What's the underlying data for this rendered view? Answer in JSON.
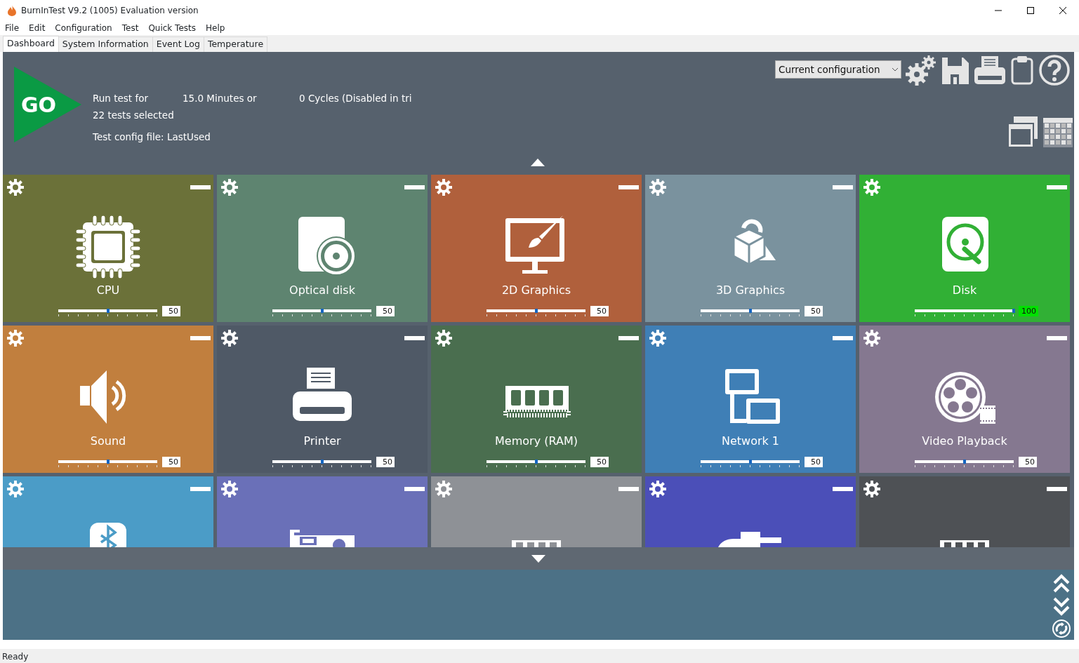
{
  "window": {
    "title": "BurnInTest V9.2 (1005) Evaluation version"
  },
  "menu": [
    "File",
    "Edit",
    "Configuration",
    "Test",
    "Quick Tests",
    "Help"
  ],
  "tabs": [
    {
      "label": "Dashboard",
      "selected": true
    },
    {
      "label": "System Information",
      "selected": false
    },
    {
      "label": "Event Log",
      "selected": false
    },
    {
      "label": "Temperature",
      "selected": false
    }
  ],
  "go_button": "GO",
  "run_info": {
    "run_label": "Run test for",
    "duration": "15.0 Minutes or",
    "cycles": "0 Cycles (Disabled in tri",
    "tests_selected": "22 tests selected",
    "config_file": "Test config file: LastUsed"
  },
  "config_select": {
    "value": "Current configuration"
  },
  "tiles": [
    {
      "kind": "cpu",
      "name": "CPU",
      "color": "#6b7139",
      "level": 0.5,
      "reading": "50",
      "maxed": false
    },
    {
      "kind": "optical",
      "name": "Optical disk",
      "color": "#5e8470",
      "level": 0.5,
      "reading": "50",
      "maxed": false
    },
    {
      "kind": "graphics2d",
      "name": "2D Graphics",
      "color": "#b0603c",
      "level": 0.5,
      "reading": "50",
      "maxed": false
    },
    {
      "kind": "graphics3d",
      "name": "3D Graphics",
      "color": "#7a929e",
      "level": 0.5,
      "reading": "50",
      "maxed": false
    },
    {
      "kind": "disk",
      "name": "Disk",
      "color": "#31b035",
      "level": 1,
      "reading": "100",
      "maxed": true
    },
    {
      "kind": "sound",
      "name": "Sound",
      "color": "#c17f3e",
      "level": 0.5,
      "reading": "50",
      "maxed": false
    },
    {
      "kind": "printer",
      "name": "Printer",
      "color": "#4f5966",
      "level": 0.5,
      "reading": "50",
      "maxed": false
    },
    {
      "kind": "memory",
      "name": "Memory (RAM)",
      "color": "#4a6e4f",
      "level": 0.5,
      "reading": "50",
      "maxed": false
    },
    {
      "kind": "network",
      "name": "Network 1",
      "color": "#3f7fb6",
      "level": 0.5,
      "reading": "50",
      "maxed": false
    },
    {
      "kind": "video",
      "name": "Video Playback",
      "color": "#857890",
      "level": 0.5,
      "reading": "50",
      "maxed": false
    },
    {
      "kind": "bluetooth",
      "color": "#4b9cc7"
    },
    {
      "kind": "card",
      "color": "#6a70b8"
    },
    {
      "kind": "memory",
      "color": "#8e9196"
    },
    {
      "kind": "plug",
      "color": "#4b4fb8"
    },
    {
      "kind": "memory",
      "color": "#4e5155"
    }
  ],
  "status_bar": "Ready"
}
